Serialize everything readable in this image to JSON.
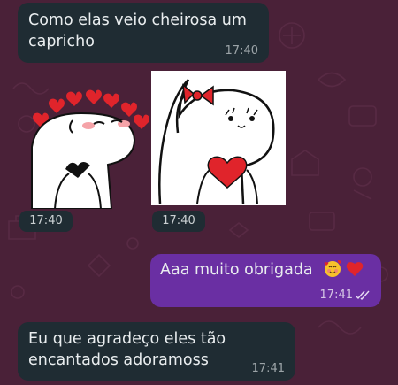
{
  "colors": {
    "wallpaper": "#4a2138",
    "incoming_bubble": "#1f2c33",
    "outgoing_bubble": "#6a2fa3",
    "text": "#e9edef",
    "heart_red": "#e0242b"
  },
  "messages": [
    {
      "direction": "incoming",
      "text": "Como elas veio cheirosa um\ncapricho",
      "time": "17:40"
    },
    {
      "direction": "incoming",
      "type": "sticker",
      "sticker": "flork-hearts-sticker",
      "time": "17:40"
    },
    {
      "direction": "incoming",
      "type": "sticker",
      "sticker": "flork-bow-heart-sticker",
      "time": "17:40"
    },
    {
      "direction": "outgoing",
      "text": "Aaa muito obrigada",
      "emojis": [
        "smiling-face-with-hearts-emoji",
        "red-heart-emoji"
      ],
      "time": "17:41",
      "status": "read"
    },
    {
      "direction": "incoming",
      "text": "Eu que agradeço eles tão\nencantados  adoramoss",
      "time": "17:41"
    }
  ]
}
